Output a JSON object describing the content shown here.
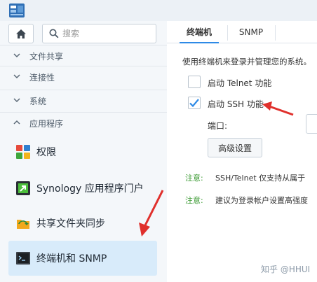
{
  "search": {
    "placeholder": "搜索"
  },
  "sidebar": {
    "categories": [
      {
        "label": "文件共享",
        "chevron": "chevron-down-icon"
      },
      {
        "label": "连接性",
        "chevron": "chevron-down-icon"
      },
      {
        "label": "系统",
        "chevron": "chevron-down-icon"
      },
      {
        "label": "应用程序",
        "chevron": "chevron-up-icon"
      }
    ],
    "items": [
      {
        "label": "权限",
        "icon": "permissions-icon"
      },
      {
        "label": "Synology 应用程序门户",
        "icon": "app-portal-icon"
      },
      {
        "label": "共享文件夹同步",
        "icon": "shared-folder-sync-icon"
      },
      {
        "label": "终端机和 SNMP",
        "icon": "terminal-icon",
        "active": true
      }
    ]
  },
  "tabs": [
    {
      "label": "终端机",
      "active": true
    },
    {
      "label": "SNMP",
      "active": false
    }
  ],
  "terminal": {
    "description": "使用终端机来登录并管理您的系统。",
    "telnet_label": "启动 Telnet 功能",
    "telnet_checked": false,
    "ssh_label": "启动 SSH 功能",
    "ssh_checked": true,
    "port_label": "端口:",
    "advanced_button": "高级设置",
    "notes": [
      {
        "key": "注意:",
        "text": "SSH/Telnet 仅支持从属于"
      },
      {
        "key": "注意:",
        "text": "建议为登录帐户设置高强度"
      }
    ]
  },
  "watermark": "知乎 @HHUI",
  "colors": {
    "accent": "#2e8ae6",
    "annotation_arrow": "#e0302c",
    "note": "#3d9b35"
  }
}
